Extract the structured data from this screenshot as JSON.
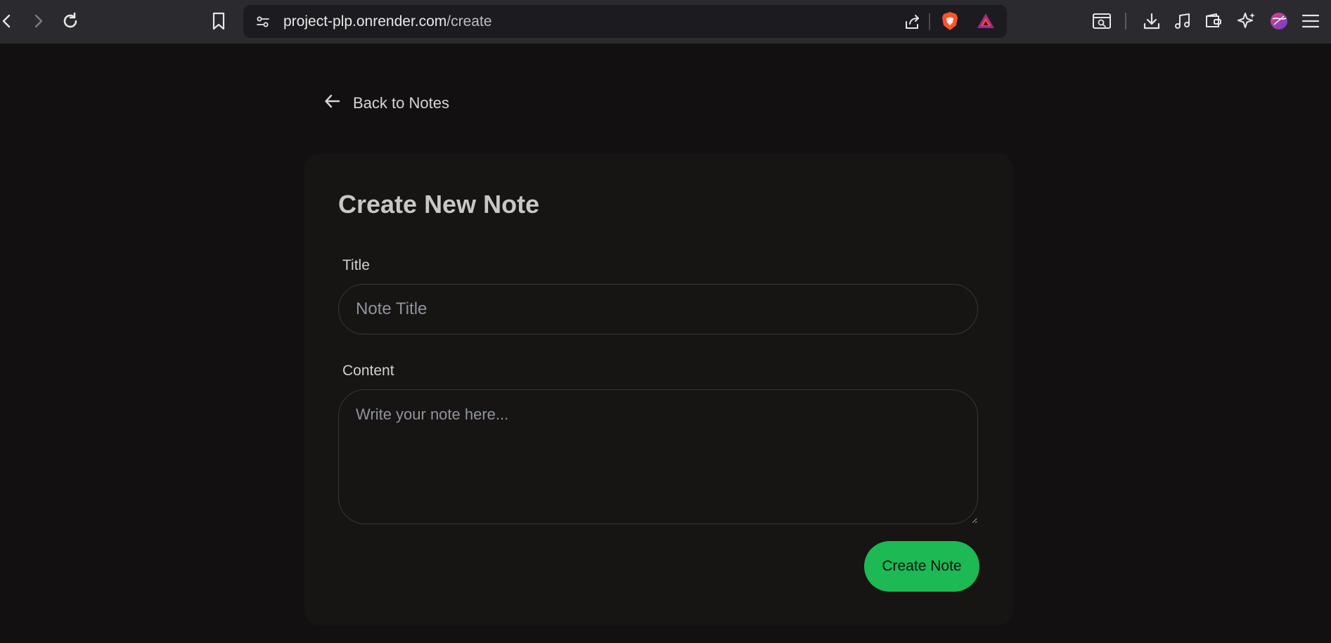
{
  "browser": {
    "url_host": "project-plp.onrender.com",
    "url_path": "/create",
    "icons": {
      "back": "arrow-left-icon",
      "forward": "arrow-right-icon",
      "reload": "reload-icon",
      "bookmark": "bookmark-icon",
      "site_settings": "sliders-icon",
      "share": "share-icon",
      "brave_shields": "lion-shield-icon",
      "rewards": "triangle-icon",
      "reader": "reader-mode-icon",
      "downloads": "download-icon",
      "media": "music-icon",
      "wallet": "wallet-icon",
      "leo": "sparkle-icon",
      "profile": "avatar-icon",
      "menu": "hamburger-icon"
    }
  },
  "page": {
    "back_link": "Back to Notes",
    "form": {
      "heading": "Create New Note",
      "title_label": "Title",
      "title_placeholder": "Note Title",
      "title_value": "",
      "content_label": "Content",
      "content_placeholder": "Write your note here...",
      "content_value": "",
      "submit_label": "Create Note"
    }
  },
  "colors": {
    "page_bg": "#121010",
    "card_bg": "#171414",
    "accent": "#1db954",
    "toolbar_bg": "#2b2a2e"
  }
}
